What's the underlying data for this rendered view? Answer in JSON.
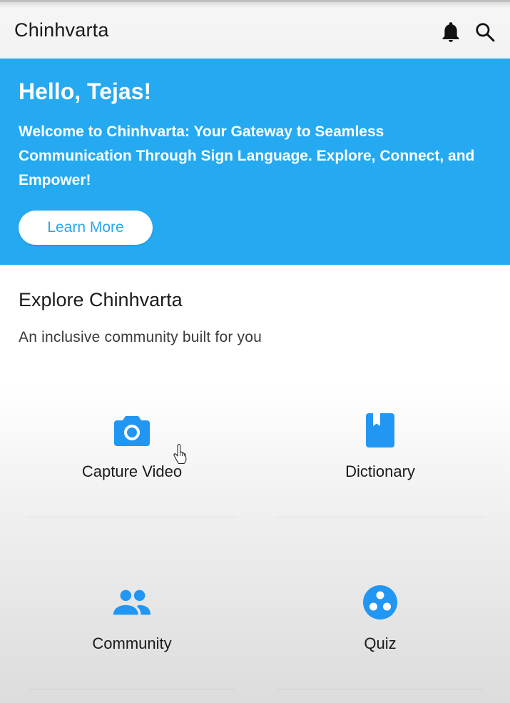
{
  "app_bar": {
    "title": "Chinhvarta",
    "notifications_icon": "bell-icon",
    "search_icon": "search-icon"
  },
  "hero": {
    "greeting": "Hello, Tejas!",
    "message": "Welcome to Chinhvarta: Your Gateway to Seamless Communication Through Sign Language. Explore, Connect, and Empower!",
    "button_label": "Learn More",
    "background_color": "#25aaf2"
  },
  "explore": {
    "title": "Explore Chinhvarta",
    "subtitle": "An inclusive community built for you"
  },
  "features": [
    {
      "label": "Capture Video",
      "icon": "camera-icon"
    },
    {
      "label": "Dictionary",
      "icon": "book-icon"
    },
    {
      "label": "Community",
      "icon": "people-icon"
    },
    {
      "label": "Quiz",
      "icon": "quiz-icon"
    }
  ],
  "accent_color": "#2196f3"
}
